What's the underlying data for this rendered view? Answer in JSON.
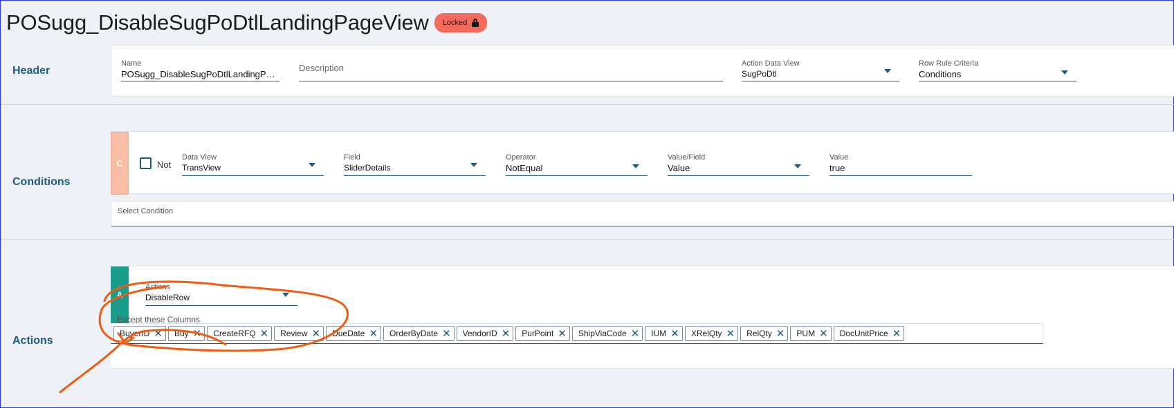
{
  "page": {
    "title": "POSugg_DisableSugPoDtlLandingPageView",
    "badge": "Locked"
  },
  "header": {
    "label": "Header",
    "name": {
      "label": "Name",
      "value": "POSugg_DisableSugPoDtlLandingPag..."
    },
    "description": {
      "placeholder": "Description"
    },
    "action_data_view": {
      "label": "Action Data View",
      "value": "SugPoDtl"
    },
    "row_rule_criteria": {
      "label": "Row Rule Criteria",
      "value": "Conditions"
    }
  },
  "conditions": {
    "label": "Conditions",
    "tag": "C",
    "not_label": "Not",
    "data_view": {
      "label": "Data View",
      "value": "TransView"
    },
    "field": {
      "label": "Field",
      "value": "SliderDetails"
    },
    "operator": {
      "label": "Operator",
      "value": "NotEqual"
    },
    "value_field": {
      "label": "Value/Field",
      "value": "Value"
    },
    "value": {
      "label": "Value",
      "value": "true"
    },
    "select_condition": {
      "label": "Select Condition"
    }
  },
  "actions": {
    "label": "Actions",
    "tag": "A",
    "actions_field": {
      "label": "Actions",
      "value": "DisableRow"
    },
    "except_label": "Except these Columns",
    "columns": [
      "BuyerID",
      "Buy",
      "CreateRFQ",
      "Review",
      "DueDate",
      "OrderByDate",
      "VendorID",
      "PurPoint",
      "ShipViaCode",
      "IUM",
      "XRelQty",
      "RelQty",
      "PUM",
      "DocUnitPrice"
    ]
  },
  "colors": {
    "accent": "#1f5c7a",
    "badge": "#f26b5c",
    "condition_tag": "#f9bca4",
    "action_tag": "#1a9c8c",
    "annotation": "#f25a0f"
  }
}
